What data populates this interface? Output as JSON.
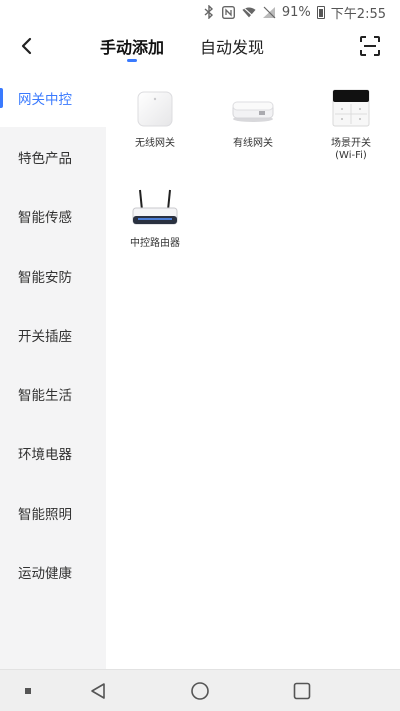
{
  "status_bar": {
    "battery_percent": "91%",
    "time": "下午2:55",
    "icons": [
      "bluetooth-icon",
      "nfc-icon",
      "wifi-icon",
      "no-signal-icon",
      "battery-icon"
    ]
  },
  "header": {
    "tabs": [
      {
        "label": "手动添加",
        "active": true
      },
      {
        "label": "自动发现",
        "active": false
      }
    ],
    "back_icon": "back-chevron-icon",
    "scan_icon": "scan-icon"
  },
  "sidebar": {
    "items": [
      {
        "label": "网关中控",
        "active": true
      },
      {
        "label": "特色产品",
        "active": false
      },
      {
        "label": "智能传感",
        "active": false
      },
      {
        "label": "智能安防",
        "active": false
      },
      {
        "label": "开关插座",
        "active": false
      },
      {
        "label": "智能生活",
        "active": false
      },
      {
        "label": "环境电器",
        "active": false
      },
      {
        "label": "智能照明",
        "active": false
      },
      {
        "label": "运动健康",
        "active": false
      }
    ]
  },
  "devices": [
    {
      "name": "无线网关",
      "sub": "",
      "icon": "wireless-gateway-icon"
    },
    {
      "name": "有线网关",
      "sub": "",
      "icon": "wired-gateway-icon"
    },
    {
      "name": "场景开关",
      "sub": "(Wi-Fi)",
      "icon": "scene-switch-icon"
    },
    {
      "name": "中控路由器",
      "sub": "",
      "icon": "router-icon"
    }
  ],
  "colors": {
    "accent": "#3a7afe",
    "sidebar_bg": "#f4f4f5",
    "nav_bg": "#efefef"
  }
}
